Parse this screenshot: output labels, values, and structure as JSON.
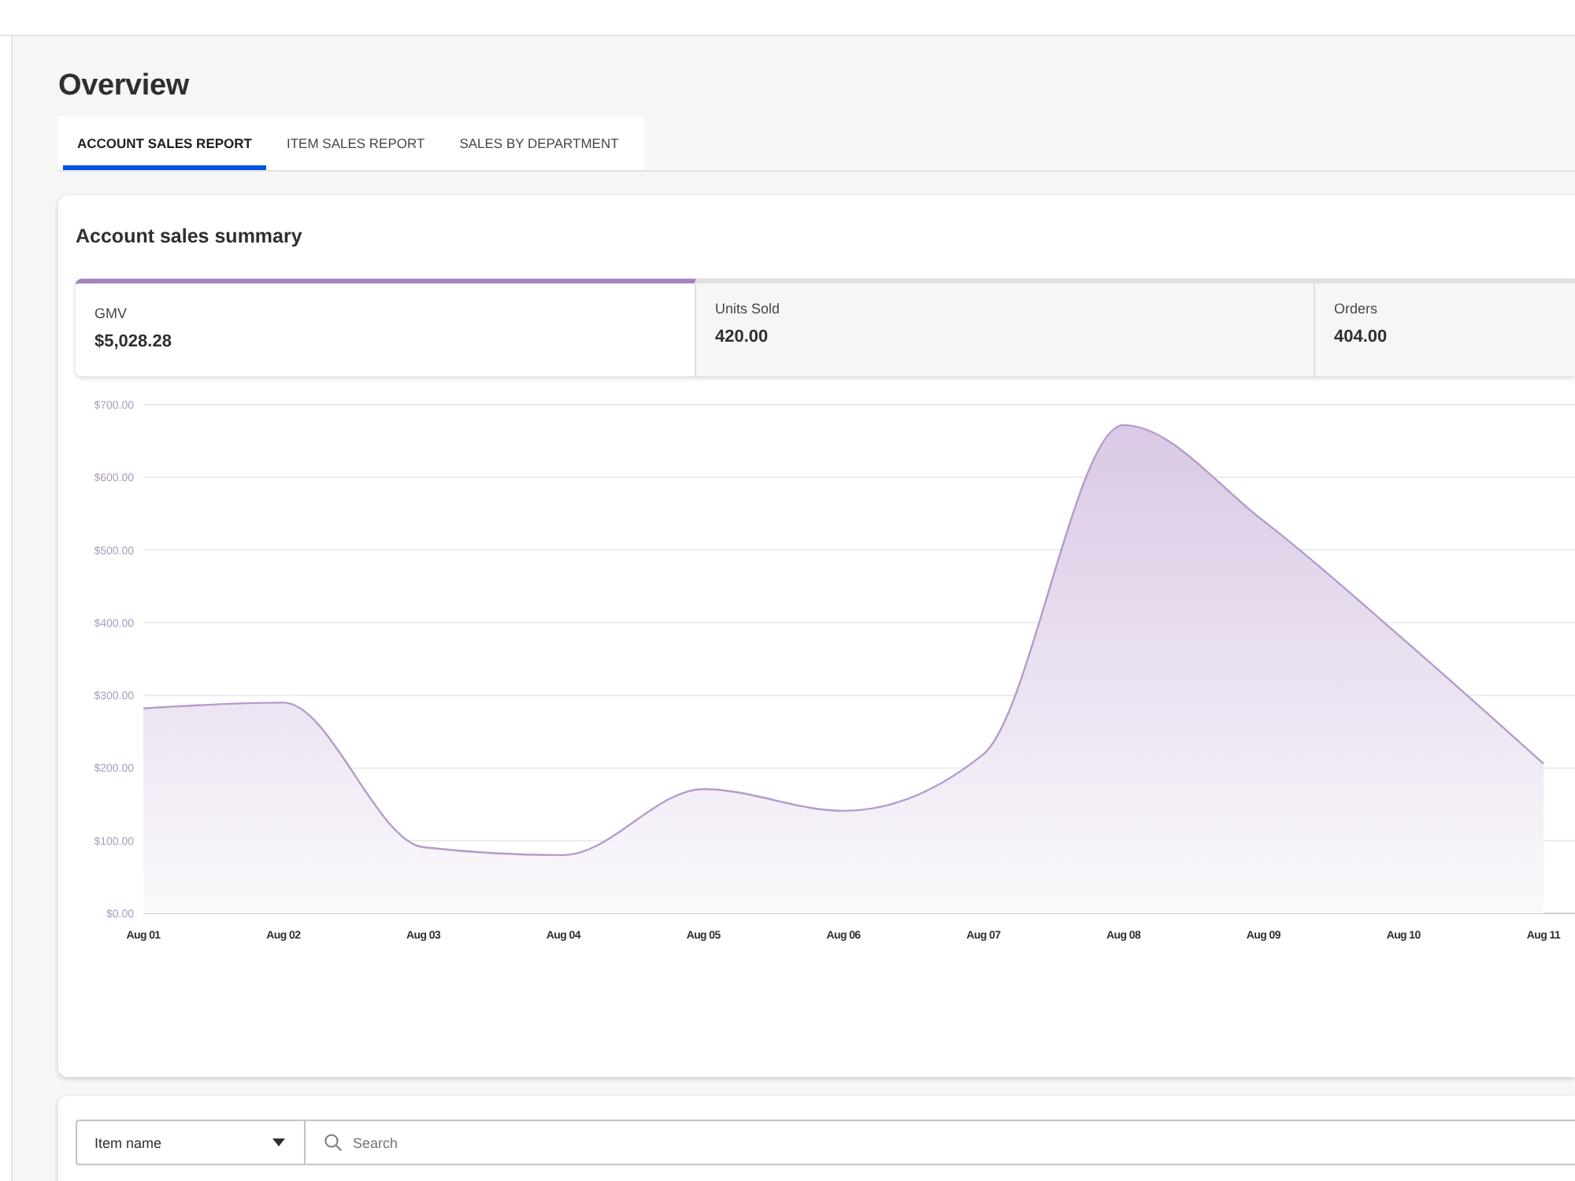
{
  "page": {
    "title": "Overview"
  },
  "tabs": [
    {
      "label": "ACCOUNT SALES REPORT",
      "selected": true
    },
    {
      "label": "ITEM SALES REPORT",
      "selected": false
    },
    {
      "label": "SALES BY DEPARTMENT",
      "selected": false
    }
  ],
  "summary": {
    "title": "Account sales summary",
    "metrics": [
      {
        "label": "GMV",
        "value": "$5,028.28",
        "selected": true
      },
      {
        "label": "Units Sold",
        "value": "420.00",
        "selected": false
      },
      {
        "label": "Orders",
        "value": "404.00",
        "selected": false
      }
    ],
    "chart_data": {
      "type": "area",
      "categories": [
        "Aug 01",
        "Aug 02",
        "Aug 03",
        "Aug 04",
        "Aug 05",
        "Aug 06",
        "Aug 07",
        "Aug 08",
        "Aug 09",
        "Aug 10",
        "Aug 11"
      ],
      "values": [
        282,
        290,
        91,
        80,
        171,
        141,
        219,
        672,
        540,
        377,
        206
      ],
      "ylim": [
        0,
        700
      ],
      "yticks": [
        {
          "value": 0,
          "label": "$0.00"
        },
        {
          "value": 100,
          "label": "$100.00"
        },
        {
          "value": 200,
          "label": "$200.00"
        },
        {
          "value": 300,
          "label": "$300.00"
        },
        {
          "value": 400,
          "label": "$400.00"
        },
        {
          "value": 500,
          "label": "$500.00"
        },
        {
          "value": 600,
          "label": "$600.00"
        },
        {
          "value": 700,
          "label": "$700.00"
        }
      ],
      "grid": true
    }
  },
  "filter": {
    "field": {
      "value": "Item name"
    },
    "search": {
      "placeholder": "Search"
    }
  }
}
